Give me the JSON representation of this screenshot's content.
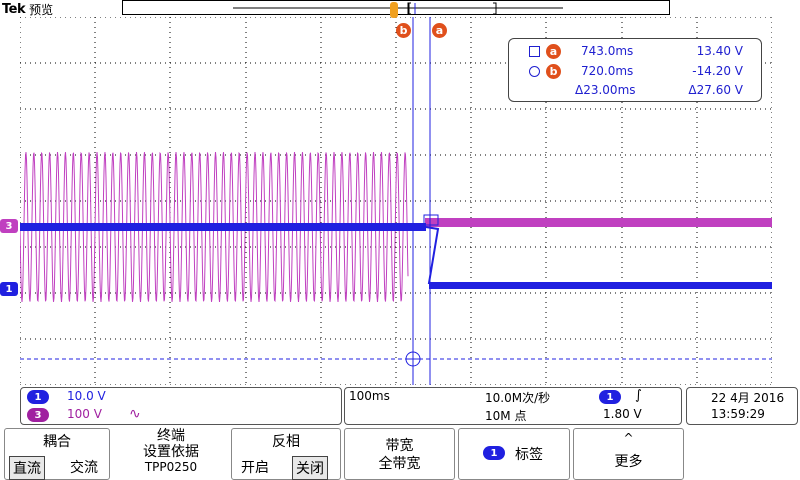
{
  "brand": {
    "logo": "Tek",
    "mode": "预览"
  },
  "cursor": {
    "a": {
      "badge": "a",
      "time": "743.0ms",
      "value": "13.40 V"
    },
    "b": {
      "badge": "b",
      "time": "720.0ms",
      "value": "-14.20 V"
    },
    "delta": {
      "time": "Δ23.00ms",
      "value": "Δ27.60 V"
    }
  },
  "channels": {
    "ch1": {
      "num": "1",
      "scale": "10.0 V",
      "color": "#2020e0"
    },
    "ch3": {
      "num": "3",
      "scale": "100 V",
      "coupling_symbol": "∿",
      "color": "#c040c0"
    }
  },
  "timebase": {
    "scale": "100ms",
    "sample_rate": "10.0M次/秒",
    "record": "10M 点",
    "trigger_source": "1",
    "trigger_slope": "∫",
    "trigger_level": "1.80 V"
  },
  "datetime": {
    "date": "22 4月 2016",
    "time": "13:59:29"
  },
  "menu": {
    "coupling": {
      "title": "耦合",
      "opt1": "直流",
      "opt2": "交流"
    },
    "termination": {
      "title1": "终端",
      "title2": "设置依据",
      "value": "TPP0250"
    },
    "invert": {
      "title": "反相",
      "opt1": "开启",
      "opt2": "关闭"
    },
    "bandwidth": {
      "title": "带宽",
      "value": "全带宽"
    },
    "label": {
      "num": "1",
      "text": "标签"
    },
    "more": {
      "arrow": "^",
      "text": "更多"
    }
  }
}
